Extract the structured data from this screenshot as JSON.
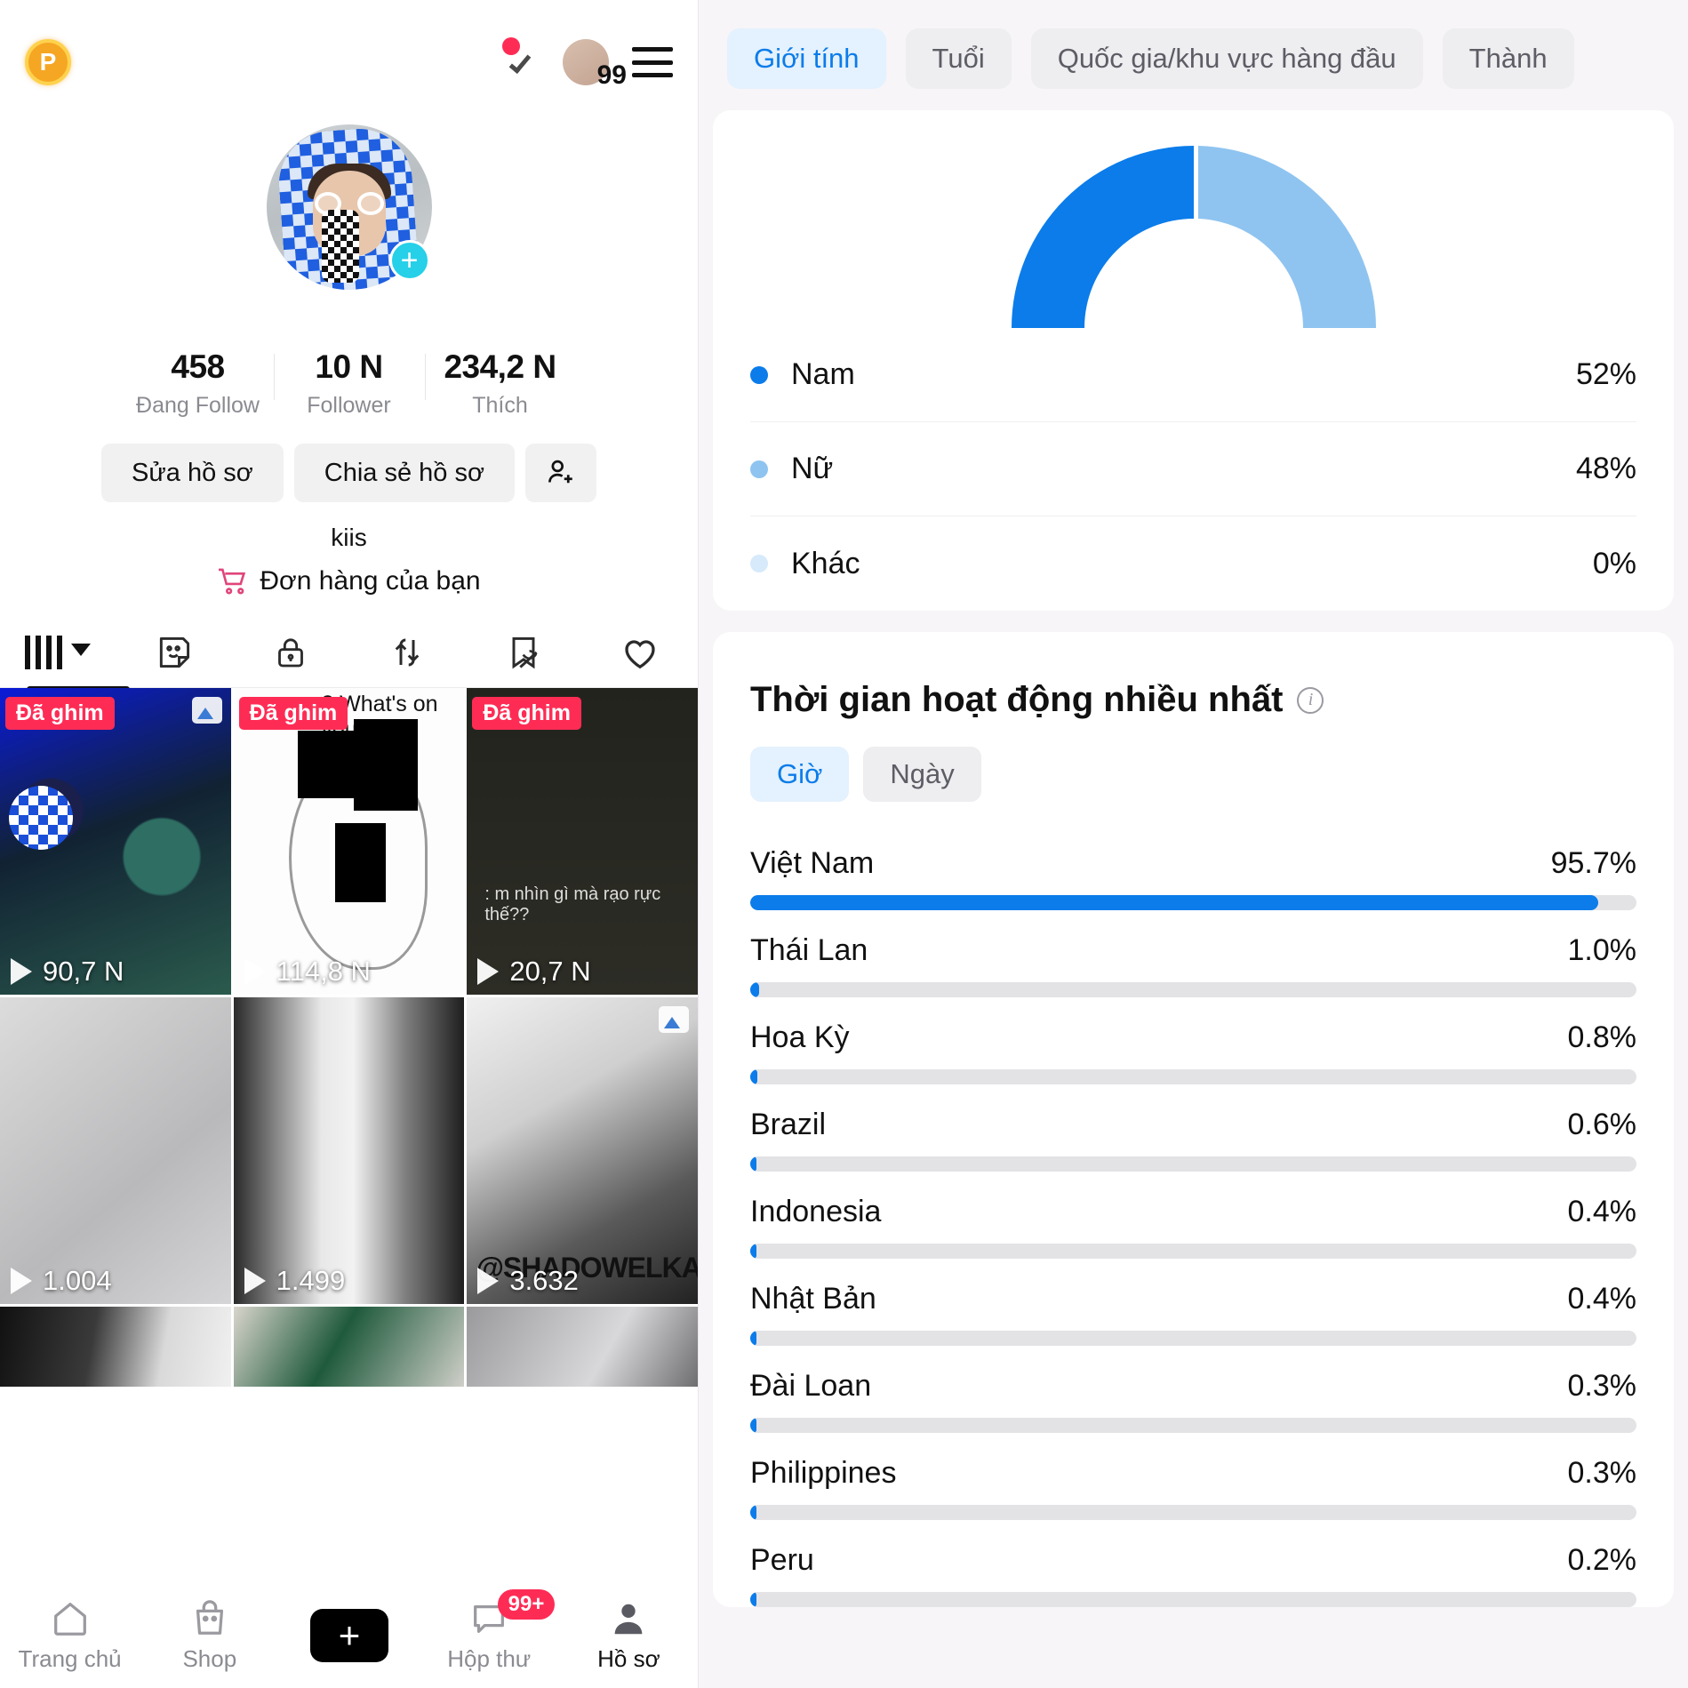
{
  "profile": {
    "coin_badge": "P",
    "notify_count": "99",
    "stats": [
      {
        "value": "458",
        "label": "Đang Follow"
      },
      {
        "value": "10 N",
        "label": "Follower"
      },
      {
        "value": "234,2 N",
        "label": "Thích"
      }
    ],
    "edit_profile_label": "Sửa hồ sơ",
    "share_profile_label": "Chia sẻ hồ sơ",
    "username": "kiis",
    "orders_label": "Đơn hàng của bạn",
    "tabs": [
      {
        "name": "grid",
        "icon": "grid-icon",
        "active": true
      },
      {
        "name": "sticker",
        "icon": "sticker-icon",
        "active": false
      },
      {
        "name": "private",
        "icon": "lock-icon",
        "active": false
      },
      {
        "name": "reposts",
        "icon": "repost-icon",
        "active": false
      },
      {
        "name": "saved",
        "icon": "bookmark-off-icon",
        "active": false
      },
      {
        "name": "liked",
        "icon": "heart-icon",
        "active": false
      }
    ],
    "pinned_label": "Đã ghim",
    "videos": [
      {
        "views": "90,7 N",
        "pinned": true,
        "multi": true
      },
      {
        "views": "114,8 N",
        "pinned": true,
        "caption": "? What's on your d?"
      },
      {
        "views": "20,7 N",
        "pinned": true,
        "comment": ": m nhìn gì mà rạo rực thế??"
      },
      {
        "views": "1.004",
        "pinned": false
      },
      {
        "views": "1.499",
        "pinned": false
      },
      {
        "views": "3.632",
        "pinned": false,
        "watermark": "@SHADOWELKAISER",
        "multi": true
      }
    ],
    "nav": [
      {
        "label": "Trang chủ",
        "icon": "home-icon",
        "active": false
      },
      {
        "label": "Shop",
        "icon": "shop-bag-icon",
        "active": false
      },
      {
        "label": "",
        "icon": "create-plus-icon",
        "active": false
      },
      {
        "label": "Hộp thư",
        "icon": "inbox-icon",
        "badge": "99+",
        "active": false
      },
      {
        "label": "Hồ sơ",
        "icon": "person-icon",
        "active": true
      }
    ]
  },
  "analytics": {
    "filter_chips": [
      {
        "label": "Giới tính",
        "active": true
      },
      {
        "label": "Tuổi",
        "active": false
      },
      {
        "label": "Quốc gia/khu vực hàng đầu",
        "active": false
      },
      {
        "label": "Thành",
        "active": false
      }
    ],
    "activity_title": "Thời gian hoạt động nhiều nhất",
    "time_chips": [
      {
        "label": "Giờ",
        "active": true
      },
      {
        "label": "Ngày",
        "active": false
      }
    ]
  },
  "colors": {
    "accent_blue": "#0b7cea",
    "light_blue": "#8fc4f0",
    "pale_blue": "#d6eafb",
    "track_grey": "#e3e2e5",
    "pink_red": "#fe2c55"
  },
  "chart_data": [
    {
      "type": "pie",
      "title": "Giới tính",
      "variant": "half-donut",
      "categories": [
        "Nam",
        "Nữ",
        "Khác"
      ],
      "values": [
        52,
        48,
        0
      ],
      "labels": [
        "52%",
        "48%",
        "0%"
      ],
      "colors": [
        "#0b7cea",
        "#8fc4f0",
        "#d6eafb"
      ],
      "legend": "below",
      "unit": "%"
    },
    {
      "type": "bar",
      "variant": "horizontal-progress",
      "title": "Thời gian hoạt động nhiều nhất",
      "categories": [
        "Việt Nam",
        "Thái Lan",
        "Hoa Kỳ",
        "Brazil",
        "Indonesia",
        "Nhật Bản",
        "Đài Loan",
        "Philippines",
        "Peru"
      ],
      "values": [
        95.7,
        1.0,
        0.8,
        0.6,
        0.4,
        0.4,
        0.3,
        0.3,
        0.2
      ],
      "labels": [
        "95.7%",
        "1.0%",
        "0.8%",
        "0.6%",
        "0.4%",
        "0.4%",
        "0.3%",
        "0.3%",
        "0.2%"
      ],
      "xlabel": "",
      "ylabel": "",
      "xlim": [
        0,
        100
      ],
      "grid": false,
      "bar_color": "#0b7cea",
      "track_color": "#e3e2e5"
    }
  ]
}
